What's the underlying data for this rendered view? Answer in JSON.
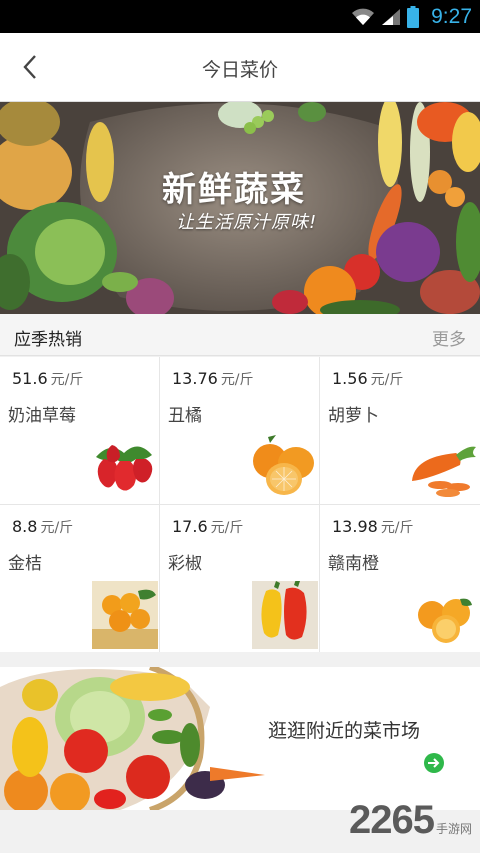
{
  "status_bar": {
    "time": "9:27"
  },
  "header": {
    "title": "今日菜价"
  },
  "banner": {
    "headline": "新鲜蔬菜",
    "tagline": "让生活原汁原味!"
  },
  "section": {
    "title": "应季热销",
    "more_label": "更多"
  },
  "unit": "元/斤",
  "products": [
    {
      "price": "51.6",
      "unit": "元/斤",
      "name": "奶油草莓"
    },
    {
      "price": "13.76",
      "unit": "元/斤",
      "name": "丑橘"
    },
    {
      "price": "1.56",
      "unit": "元/斤",
      "name": "胡萝卜"
    },
    {
      "price": "8.8",
      "unit": "元/斤",
      "name": "金桔"
    },
    {
      "price": "17.6",
      "unit": "元/斤",
      "name": "彩椒"
    },
    {
      "price": "13.98",
      "unit": "元/斤",
      "name": "赣南橙"
    }
  ],
  "market_banner": {
    "text": "逛逛附近的菜市场"
  },
  "watermark": {
    "number": "2265",
    "site": "手游网"
  },
  "colors": {
    "accent": "#38b3e9",
    "go_green": "#2fb84a"
  }
}
